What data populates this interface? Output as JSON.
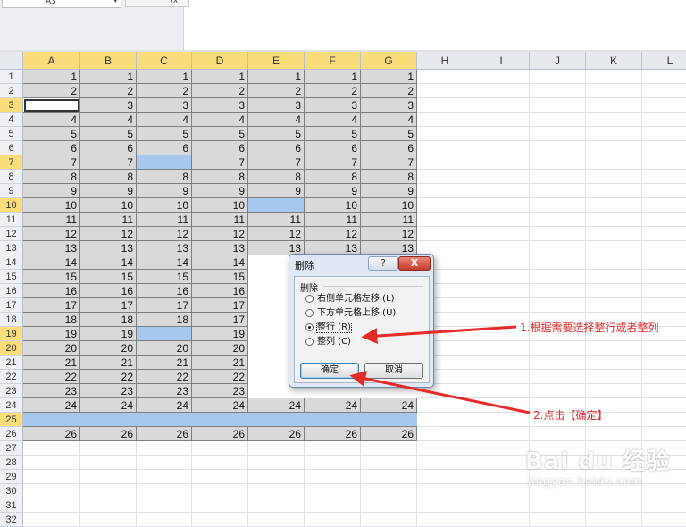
{
  "formula_bar": {
    "name_box": "A3",
    "fx_label": "fx"
  },
  "columns": [
    "A",
    "B",
    "C",
    "D",
    "E",
    "F",
    "G",
    "H",
    "I",
    "J",
    "K",
    "L"
  ],
  "selected_columns": [
    "A",
    "B",
    "C",
    "D",
    "E",
    "F",
    "G"
  ],
  "rows": [
    1,
    2,
    3,
    4,
    5,
    6,
    7,
    8,
    9,
    10,
    11,
    12,
    13,
    14,
    15,
    16,
    17,
    18,
    19,
    20,
    21,
    22,
    23,
    24,
    25,
    26,
    27,
    28,
    29,
    30,
    31,
    32
  ],
  "selected_rows": [
    3,
    7,
    10,
    19,
    20,
    25
  ],
  "active_cell": "A3",
  "table": {
    "values": [
      [
        1,
        1,
        1,
        1,
        1,
        1,
        1
      ],
      [
        2,
        2,
        2,
        2,
        2,
        2,
        2
      ],
      [
        null,
        3,
        3,
        3,
        3,
        3,
        3
      ],
      [
        4,
        4,
        4,
        4,
        4,
        4,
        4
      ],
      [
        5,
        5,
        5,
        5,
        5,
        5,
        5
      ],
      [
        6,
        6,
        6,
        6,
        6,
        6,
        6
      ],
      [
        7,
        7,
        null,
        7,
        7,
        7,
        7
      ],
      [
        8,
        8,
        8,
        8,
        8,
        8,
        8
      ],
      [
        9,
        9,
        9,
        9,
        9,
        9,
        9
      ],
      [
        10,
        10,
        10,
        10,
        null,
        10,
        10
      ],
      [
        11,
        11,
        11,
        11,
        11,
        11,
        11
      ],
      [
        12,
        12,
        12,
        12,
        12,
        12,
        12
      ],
      [
        13,
        13,
        13,
        13,
        13,
        13,
        13
      ],
      [
        14,
        14,
        14,
        14,
        null,
        null,
        null
      ],
      [
        15,
        15,
        15,
        15,
        null,
        null,
        null
      ],
      [
        16,
        16,
        16,
        16,
        null,
        null,
        null
      ],
      [
        17,
        17,
        17,
        17,
        null,
        null,
        null
      ],
      [
        18,
        18,
        18,
        17,
        null,
        null,
        null
      ],
      [
        19,
        19,
        null,
        19,
        null,
        null,
        null
      ],
      [
        20,
        20,
        20,
        20,
        null,
        null,
        null
      ],
      [
        21,
        21,
        21,
        21,
        null,
        null,
        null
      ],
      [
        22,
        22,
        22,
        22,
        null,
        null,
        null
      ],
      [
        23,
        23,
        23,
        23,
        null,
        null,
        null
      ],
      [
        24,
        24,
        24,
        24,
        24,
        24,
        24
      ],
      [
        null,
        null,
        null,
        null,
        null,
        null,
        null
      ],
      [
        26,
        26,
        26,
        26,
        26,
        26,
        26
      ]
    ],
    "blank_cells": [
      "C7",
      "E10",
      "C19"
    ],
    "blank_rows": [
      25
    ]
  },
  "dialog": {
    "title": "删除",
    "help_label": "?",
    "close_label": "X",
    "group_label": "删除",
    "options": [
      {
        "label": "右侧单元格左移 (L)",
        "selected": false
      },
      {
        "label": "下方单元格上移 (U)",
        "selected": false
      },
      {
        "label": "整行 (R)",
        "selected": true
      },
      {
        "label": "整列 (C)",
        "selected": false
      }
    ],
    "ok_label": "确定",
    "cancel_label": "取消"
  },
  "annotations": {
    "step1": "1.根据需要选择整行或者整列",
    "step2": "2.点击【确定】",
    "color": "#e52a2a"
  },
  "watermark": {
    "brand": "Bai du 经验",
    "url": "jingyan.baidu.com"
  },
  "colors": {
    "selected_header": "#f9dd7b",
    "data_fill": "#d9d9d9",
    "blank_fill": "#a6c8ec"
  }
}
